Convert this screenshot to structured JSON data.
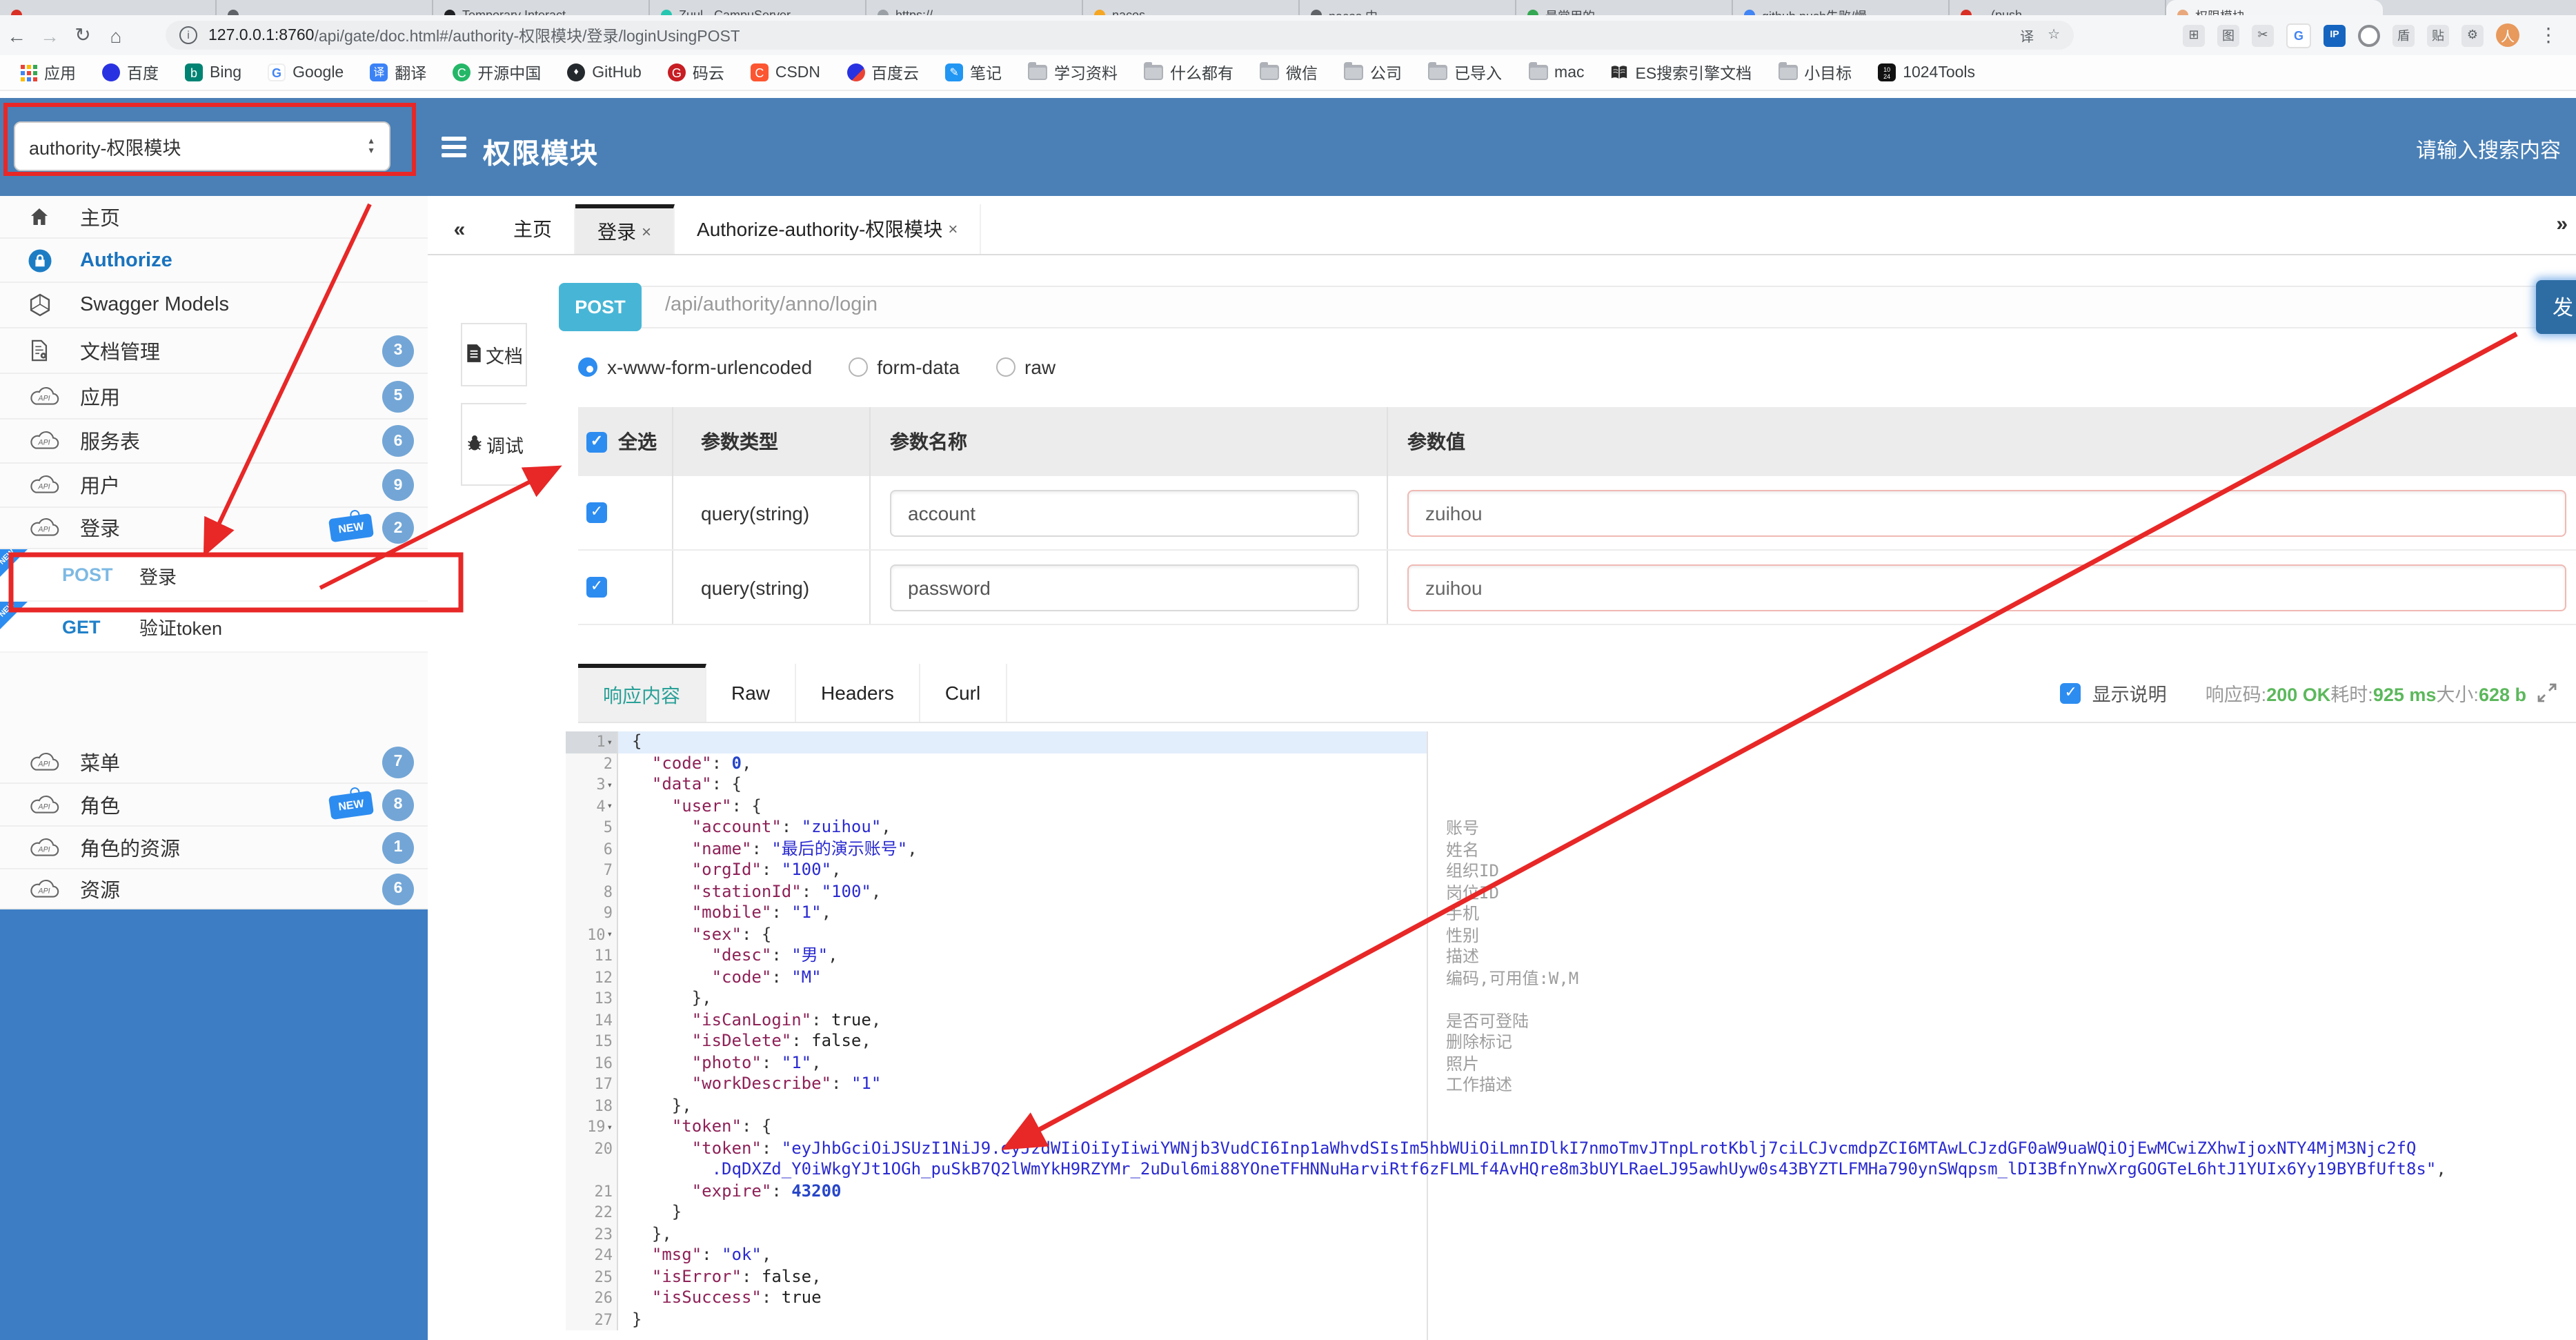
{
  "browser": {
    "tab_strip": {
      "tabs": [
        {
          "title": "",
          "color": "#d93025",
          "active": false
        },
        {
          "title": "",
          "color": "#5f6368",
          "active": false
        },
        {
          "title": "Temporary Interact…",
          "color": "#202124",
          "active": false
        },
        {
          "title": "Zuul - CampuServer…",
          "color": "#26c6b0",
          "active": false
        },
        {
          "title": "https://…",
          "color": "#9aa0a6",
          "active": false
        },
        {
          "title": "nacos",
          "color": "#f5a623",
          "active": false
        },
        {
          "title": "nacos 中…",
          "color": "#5f6368",
          "active": false
        },
        {
          "title": "最常用的…",
          "color": "#34a853",
          "active": false
        },
        {
          "title": "github push失败/慢…",
          "color": "#4285f4",
          "active": false
        },
        {
          "title": "…(push…",
          "color": "#d93025",
          "active": false
        },
        {
          "title": "权限模块",
          "color": "#e8a87c",
          "active": true
        }
      ]
    },
    "toolbar": {
      "back_icon": "←",
      "forward_icon": "→",
      "reload_icon": "↻",
      "home_icon": "⌂",
      "info_icon": "i",
      "url_host": "127.0.0.1:8760",
      "url_path": "/api/gate/doc.html#/authority-权限模块/登录/loginUsingPOST",
      "translate_icon": "译",
      "star_icon": "☆",
      "extensions": [
        {
          "name": "grid-extension-icon",
          "glyph": "⊞",
          "kind": "plain"
        },
        {
          "name": "capture-extension-icon",
          "glyph": "图",
          "kind": "plain"
        },
        {
          "name": "clip-extension-icon",
          "glyph": "✂",
          "kind": "plain"
        },
        {
          "name": "google-extension-icon",
          "glyph": "G",
          "kind": "g"
        },
        {
          "name": "ip-extension-icon",
          "glyph": "IP",
          "kind": "ip"
        },
        {
          "name": "circle-extension-icon",
          "glyph": "",
          "kind": "circ"
        },
        {
          "name": "shield-extension-icon",
          "glyph": "盾",
          "kind": "plain"
        },
        {
          "name": "pin-extension-icon",
          "glyph": "贴",
          "kind": "plain"
        },
        {
          "name": "puzzle-extension-icon",
          "glyph": "⚙",
          "kind": "plain"
        }
      ],
      "avatar_glyph": "人",
      "menu_icon": "⋮"
    },
    "bookmarks": [
      {
        "label": "应用",
        "icon": "apps"
      },
      {
        "label": "百度",
        "icon": "baidu"
      },
      {
        "label": "Bing",
        "icon": "bing"
      },
      {
        "label": "Google",
        "icon": "google"
      },
      {
        "label": "翻译",
        "icon": "translate"
      },
      {
        "label": "开源中国",
        "icon": "oschina"
      },
      {
        "label": "GitHub",
        "icon": "github"
      },
      {
        "label": "码云",
        "icon": "gitee"
      },
      {
        "label": "CSDN",
        "icon": "csdn"
      },
      {
        "label": "百度云",
        "icon": "baiduyun"
      },
      {
        "label": "笔记",
        "icon": "note"
      },
      {
        "label": "学习资料",
        "icon": "folder"
      },
      {
        "label": "什么都有",
        "icon": "folder"
      },
      {
        "label": "微信",
        "icon": "folder"
      },
      {
        "label": "公司",
        "icon": "folder"
      },
      {
        "label": "已导入",
        "icon": "folder"
      },
      {
        "label": "mac",
        "icon": "folder"
      },
      {
        "label": "ES搜索引擎文档",
        "icon": "book"
      },
      {
        "label": "小目标",
        "icon": "folder"
      },
      {
        "label": "1024Tools",
        "icon": "tools1024"
      }
    ]
  },
  "header": {
    "module_select": "authority-权限模块",
    "title": "权限模块",
    "search_placeholder": "请输入搜索内容"
  },
  "sidebar": {
    "items": [
      {
        "label": "主页",
        "icon": "home"
      },
      {
        "label": "Authorize",
        "icon": "lock",
        "style": "link"
      },
      {
        "label": "Swagger Models",
        "icon": "hex"
      },
      {
        "label": "文档管理",
        "icon": "docgear",
        "badge": "3"
      },
      {
        "label": "应用",
        "icon": "cloud",
        "badge": "5"
      },
      {
        "label": "服务表",
        "icon": "cloud",
        "badge": "6"
      },
      {
        "label": "用户",
        "icon": "cloud",
        "badge": "9"
      },
      {
        "label": "登录",
        "icon": "cloud",
        "badge": "2",
        "new": true
      }
    ],
    "sub_items": [
      {
        "method": "POST",
        "label": "登录",
        "new": true,
        "method_color": "#7db9e3"
      },
      {
        "method": "GET",
        "label": "验证token",
        "new": true,
        "method_color": "#2080c8"
      }
    ],
    "items_bottom": [
      {
        "label": "菜单",
        "icon": "cloud",
        "badge": "7"
      },
      {
        "label": "角色",
        "icon": "cloud",
        "badge": "8",
        "new": true
      },
      {
        "label": "角色的资源",
        "icon": "cloud",
        "badge": "1"
      },
      {
        "label": "资源",
        "icon": "cloud",
        "badge": "6"
      }
    ]
  },
  "workspace": {
    "collapse_icon": "«",
    "more_icon": "»",
    "tabs": [
      {
        "label": "主页",
        "closable": false,
        "active": false
      },
      {
        "label": "登录",
        "closable": true,
        "active": true
      },
      {
        "label": "Authorize-authority-权限模块",
        "closable": true,
        "active": false
      }
    ],
    "doc_tabs": [
      {
        "label": "文档",
        "icon": "doc",
        "active": false
      },
      {
        "label": "调试",
        "icon": "bug",
        "active": true
      }
    ]
  },
  "endpoint": {
    "method": "POST",
    "path": "/api/authority/anno/login",
    "send_label": "发送"
  },
  "request": {
    "content_types": [
      {
        "label": "x-www-form-urlencoded",
        "selected": true
      },
      {
        "label": "form-data",
        "selected": false
      },
      {
        "label": "raw",
        "selected": false
      }
    ],
    "table": {
      "select_all": "全选",
      "headers": [
        "参数类型",
        "参数名称",
        "参数值"
      ],
      "rows": [
        {
          "checked": true,
          "type": "query(string)",
          "name": "account",
          "value": "zuihou"
        },
        {
          "checked": true,
          "type": "query(string)",
          "name": "password",
          "value": "zuihou"
        }
      ]
    }
  },
  "response": {
    "tabs": [
      {
        "label": "响应内容",
        "active": true
      },
      {
        "label": "Raw",
        "active": false
      },
      {
        "label": "Headers",
        "active": false
      },
      {
        "label": "Curl",
        "active": false
      }
    ],
    "show_desc_label": "显示说明",
    "show_desc_checked": true,
    "stats": [
      {
        "label": "响应码:",
        "value": "200 OK"
      },
      {
        "label": "耗时:",
        "value": "925 ms"
      },
      {
        "label": "大小:",
        "value": "628 b"
      }
    ]
  },
  "code": {
    "lines": [
      {
        "n": 1,
        "fold": true,
        "hl": true,
        "seg": [
          [
            "p",
            "{"
          ]
        ]
      },
      {
        "n": 2,
        "seg": [
          [
            "p",
            "  "
          ],
          [
            "k",
            "\"code\""
          ],
          [
            "p",
            ": "
          ],
          [
            "n",
            "0"
          ],
          [
            "p",
            ","
          ]
        ]
      },
      {
        "n": 3,
        "fold": true,
        "seg": [
          [
            "p",
            "  "
          ],
          [
            "k",
            "\"data\""
          ],
          [
            "p",
            ": {"
          ]
        ]
      },
      {
        "n": 4,
        "fold": true,
        "seg": [
          [
            "p",
            "    "
          ],
          [
            "k",
            "\"user\""
          ],
          [
            "p",
            ": {"
          ]
        ]
      },
      {
        "n": 5,
        "desc": "账号",
        "seg": [
          [
            "p",
            "      "
          ],
          [
            "k",
            "\"account\""
          ],
          [
            "p",
            ": "
          ],
          [
            "s",
            "\"zuihou\""
          ],
          [
            "p",
            ","
          ]
        ]
      },
      {
        "n": 6,
        "desc": "姓名",
        "seg": [
          [
            "p",
            "      "
          ],
          [
            "k",
            "\"name\""
          ],
          [
            "p",
            ": "
          ],
          [
            "s",
            "\"最后的演示账号\""
          ],
          [
            "p",
            ","
          ]
        ]
      },
      {
        "n": 7,
        "desc": "组织ID",
        "seg": [
          [
            "p",
            "      "
          ],
          [
            "k",
            "\"orgId\""
          ],
          [
            "p",
            ": "
          ],
          [
            "s",
            "\"100\""
          ],
          [
            "p",
            ","
          ]
        ]
      },
      {
        "n": 8,
        "desc": "岗位ID",
        "seg": [
          [
            "p",
            "      "
          ],
          [
            "k",
            "\"stationId\""
          ],
          [
            "p",
            ": "
          ],
          [
            "s",
            "\"100\""
          ],
          [
            "p",
            ","
          ]
        ]
      },
      {
        "n": 9,
        "desc": "手机",
        "seg": [
          [
            "p",
            "      "
          ],
          [
            "k",
            "\"mobile\""
          ],
          [
            "p",
            ": "
          ],
          [
            "s",
            "\"1\""
          ],
          [
            "p",
            ","
          ]
        ]
      },
      {
        "n": 10,
        "fold": true,
        "desc": "性别",
        "seg": [
          [
            "p",
            "      "
          ],
          [
            "k",
            "\"sex\""
          ],
          [
            "p",
            ": {"
          ]
        ]
      },
      {
        "n": 11,
        "desc": "描述",
        "seg": [
          [
            "p",
            "        "
          ],
          [
            "k",
            "\"desc\""
          ],
          [
            "p",
            ": "
          ],
          [
            "s",
            "\"男\""
          ],
          [
            "p",
            ","
          ]
        ]
      },
      {
        "n": 12,
        "desc": "编码,可用值:W,M",
        "seg": [
          [
            "p",
            "        "
          ],
          [
            "k",
            "\"code\""
          ],
          [
            "p",
            ": "
          ],
          [
            "s",
            "\"M\""
          ]
        ]
      },
      {
        "n": 13,
        "seg": [
          [
            "p",
            "      },"
          ]
        ]
      },
      {
        "n": 14,
        "desc": "是否可登陆",
        "seg": [
          [
            "p",
            "      "
          ],
          [
            "k",
            "\"isCanLogin\""
          ],
          [
            "p",
            ": "
          ],
          [
            "b",
            "true"
          ],
          [
            "p",
            ","
          ]
        ]
      },
      {
        "n": 15,
        "desc": "删除标记",
        "seg": [
          [
            "p",
            "      "
          ],
          [
            "k",
            "\"isDelete\""
          ],
          [
            "p",
            ": "
          ],
          [
            "b",
            "false"
          ],
          [
            "p",
            ","
          ]
        ]
      },
      {
        "n": 16,
        "desc": "照片",
        "seg": [
          [
            "p",
            "      "
          ],
          [
            "k",
            "\"photo\""
          ],
          [
            "p",
            ": "
          ],
          [
            "s",
            "\"1\""
          ],
          [
            "p",
            ","
          ]
        ]
      },
      {
        "n": 17,
        "desc": "工作描述",
        "seg": [
          [
            "p",
            "      "
          ],
          [
            "k",
            "\"workDescribe\""
          ],
          [
            "p",
            ": "
          ],
          [
            "s",
            "\"1\""
          ]
        ]
      },
      {
        "n": 18,
        "seg": [
          [
            "p",
            "    },"
          ]
        ]
      },
      {
        "n": 19,
        "fold": true,
        "seg": [
          [
            "p",
            "    "
          ],
          [
            "k",
            "\"token\""
          ],
          [
            "p",
            ": {"
          ]
        ]
      },
      {
        "n": 20,
        "seg": [
          [
            "p",
            "      "
          ],
          [
            "k",
            "\"token\""
          ],
          [
            "p",
            ": "
          ],
          [
            "s",
            "\"eyJhbGciOiJSUzI1NiJ9.eyJzdWIiOiIyIiwiYWNjb3VudCI6Inp1aWhvdSIsIm5hbWUiOiLmnIDlkI7nmoTmvJTnpLrotKblj7ciLCJvcmdpZCI6MTAwLCJzdGF0aW9uaWQiOjEwMCwiZXhwIjoxNTY4MjM3Njc2fQ"
          ]
        ]
      },
      {
        "n": null,
        "seg": [
          [
            "p",
            "        "
          ],
          [
            "s",
            ".DqDXZd_Y0iWkgYJt1OGh_puSkB7Q2lWmYkH9RZYMr_2uDul6mi88YOneTFHNNuHarviRtf6zFLMLf4AvHQre8m3bUYLRaeLJ95awhUyw0s43BYZTLFMHa790ynSWqpsm_lDI3BfnYnwXrgGOGTeL6htJ1YUIx6Yy19BYBfUft8s\""
          ],
          [
            "p",
            ","
          ]
        ]
      },
      {
        "n": 21,
        "seg": [
          [
            "p",
            "      "
          ],
          [
            "k",
            "\"expire\""
          ],
          [
            "p",
            ": "
          ],
          [
            "n",
            "43200"
          ]
        ]
      },
      {
        "n": 22,
        "seg": [
          [
            "p",
            "    }"
          ]
        ]
      },
      {
        "n": 23,
        "seg": [
          [
            "p",
            "  },"
          ]
        ]
      },
      {
        "n": 24,
        "seg": [
          [
            "p",
            "  "
          ],
          [
            "k",
            "\"msg\""
          ],
          [
            "p",
            ": "
          ],
          [
            "s",
            "\"ok\""
          ],
          [
            "p",
            ","
          ]
        ]
      },
      {
        "n": 25,
        "seg": [
          [
            "p",
            "  "
          ],
          [
            "k",
            "\"isError\""
          ],
          [
            "p",
            ": "
          ],
          [
            "b",
            "false"
          ],
          [
            "p",
            ","
          ]
        ]
      },
      {
        "n": 26,
        "seg": [
          [
            "p",
            "  "
          ],
          [
            "k",
            "\"isSuccess\""
          ],
          [
            "p",
            ": "
          ],
          [
            "b",
            "true"
          ]
        ]
      },
      {
        "n": 27,
        "seg": [
          [
            "p",
            "}"
          ]
        ]
      }
    ]
  },
  "colors": {
    "header_blue": "#4a80b6",
    "sidebar_blue": "#3d7dc4",
    "method_cyan": "#47b6d6",
    "new_blue": "#2d8cf0",
    "annotation_red": "#e82727",
    "send_button_blue": "#2e6da4",
    "success_green": "#5cb85c",
    "response_teal": "#2aa198"
  }
}
